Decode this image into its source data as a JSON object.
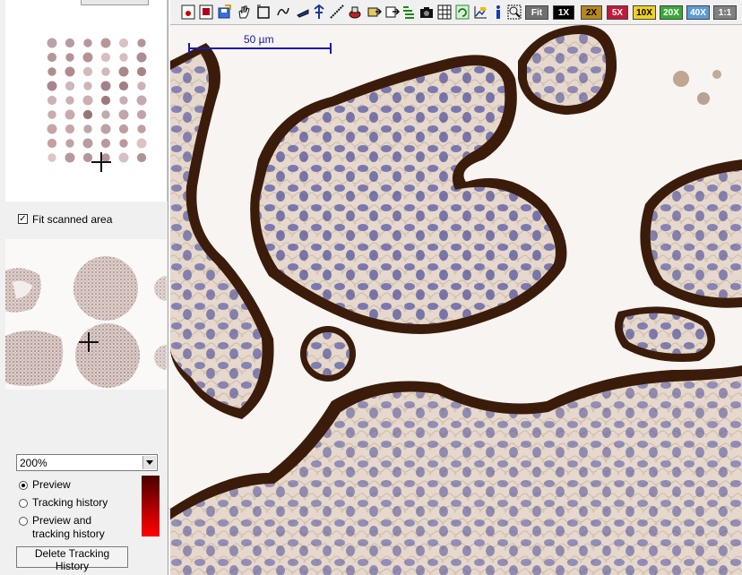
{
  "navigator": {
    "fit_scanned_area": {
      "label": "Fit scanned area",
      "checked": true
    }
  },
  "zoom": {
    "value": "200%"
  },
  "display_mode": {
    "options": [
      {
        "label": "Preview",
        "selected": true
      },
      {
        "label": "Tracking history",
        "selected": false
      },
      {
        "label": "Preview and",
        "label_line2": "tracking history",
        "selected": false
      }
    ]
  },
  "delete_button": {
    "label": "Delete Tracking History"
  },
  "toolbar": {
    "tools": [
      "record-icon",
      "stop-icon",
      "save-icon",
      "hand-pan-icon",
      "select-rectangle-icon",
      "draw-icon",
      "measure-icon",
      "move-icon",
      "ruler-icon",
      "stamp-icon",
      "export-icon",
      "list-icon",
      "camera-icon",
      "grid-icon",
      "refresh-icon",
      "chart-icon",
      "info-icon",
      "zoom-fit-icon"
    ],
    "zoom_buttons": [
      {
        "label": "Fit",
        "bg": "#707070",
        "fg": "#ffffff"
      },
      {
        "label": "1X",
        "bg": "#000000",
        "fg": "#ffffff"
      },
      {
        "label": "2X",
        "bg": "#b8861b",
        "fg": "#000000"
      },
      {
        "label": "5X",
        "bg": "#c2183a",
        "fg": "#ffffff"
      },
      {
        "label": "10X",
        "bg": "#f0d020",
        "fg": "#000000"
      },
      {
        "label": "20X",
        "bg": "#3aa838",
        "fg": "#ffffff"
      },
      {
        "label": "40X",
        "bg": "#5b9bd5",
        "fg": "#ffffff"
      },
      {
        "label": "1:1",
        "bg": "#808080",
        "fg": "#ffffff"
      }
    ]
  },
  "viewer": {
    "scale_bar": {
      "label": "50 µm",
      "color": "#1a1ab0"
    }
  },
  "colors": {
    "stain_brown": "#3d1e0c",
    "stroma": "#e8dcd0",
    "nuclei": "#5a5aa0",
    "tracking_dark": "#4a0000",
    "tracking_bright": "#ff0000"
  }
}
